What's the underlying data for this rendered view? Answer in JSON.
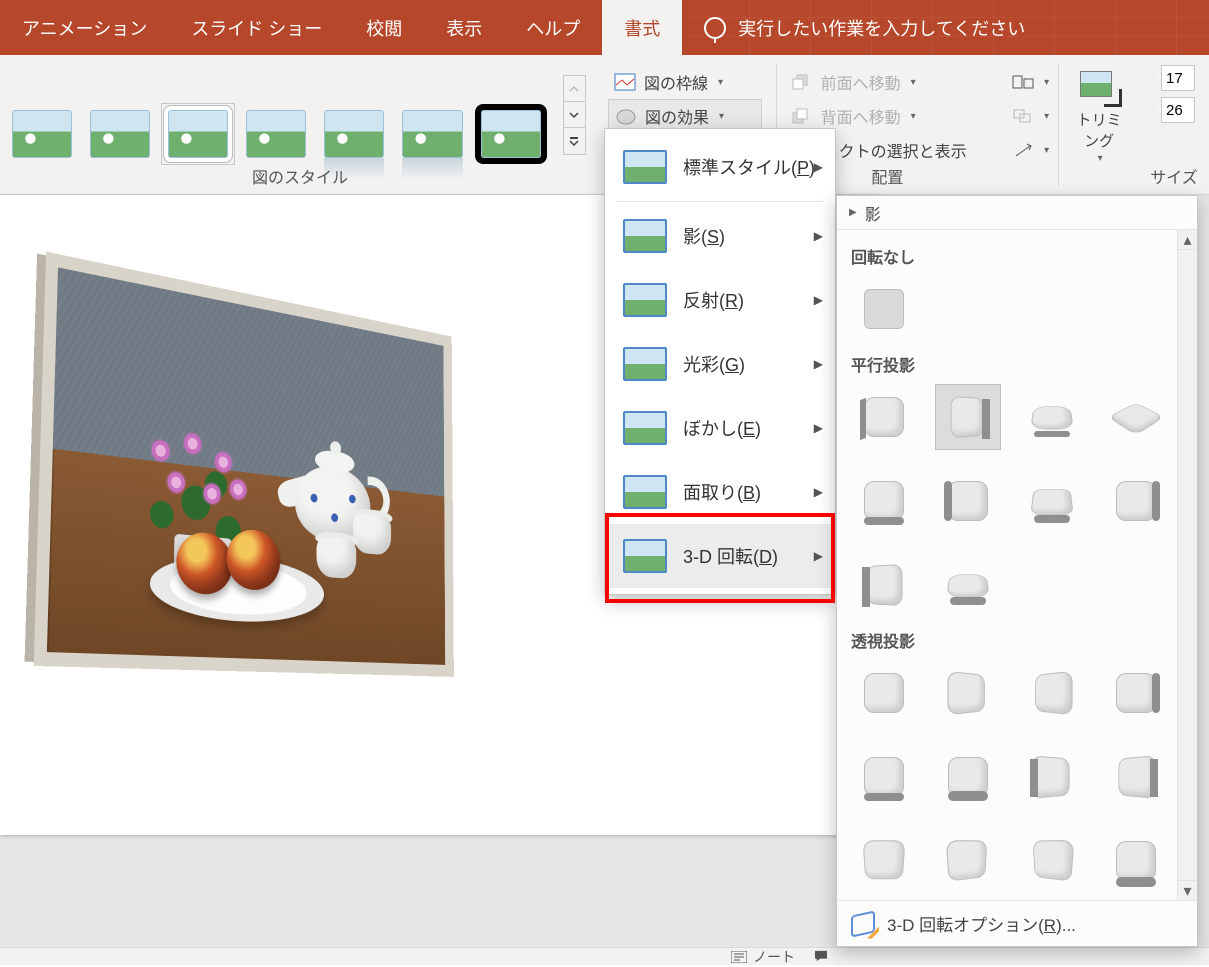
{
  "tabs": {
    "animation": "アニメーション",
    "slideshow": "スライド ショー",
    "review": "校閲",
    "view": "表示",
    "help": "ヘルプ",
    "format": "書式",
    "tellme": "実行したい作業を入力してください"
  },
  "ribbon": {
    "styles_group_label": "図のスタイル",
    "picture_border": "図の枠線",
    "picture_effects": "図の効果",
    "bring_forward": "前面へ移動",
    "send_backward": "背面へ移動",
    "selection_pane": "ブジェクトの選択と表示",
    "arrange_group_label": "配置",
    "crop_label": "トリミング",
    "size_group_label": "サイズ",
    "height_value": "17",
    "width_value": "26"
  },
  "fx_menu": {
    "preset": "標準スタイル(",
    "preset_k": "P",
    "shadow": "影(",
    "shadow_k": "S",
    "reflection": "反射(",
    "reflection_k": "R",
    "glow": "光彩(",
    "glow_k": "G",
    "soft": "ぼかし(",
    "soft_k": "E",
    "bevel": "面取り(",
    "bevel_k": "B",
    "rot3d": "3-D 回転(",
    "rot3d_k": "D",
    "close": ")"
  },
  "rot": {
    "crumb": "影",
    "h_none": "回転なし",
    "h_parallel": "平行投影",
    "h_persp": "透視投影",
    "options": "3-D 回転オプション(",
    "options_k": "R",
    "options_tail": ")..."
  },
  "status": {
    "notes": "ノート"
  }
}
